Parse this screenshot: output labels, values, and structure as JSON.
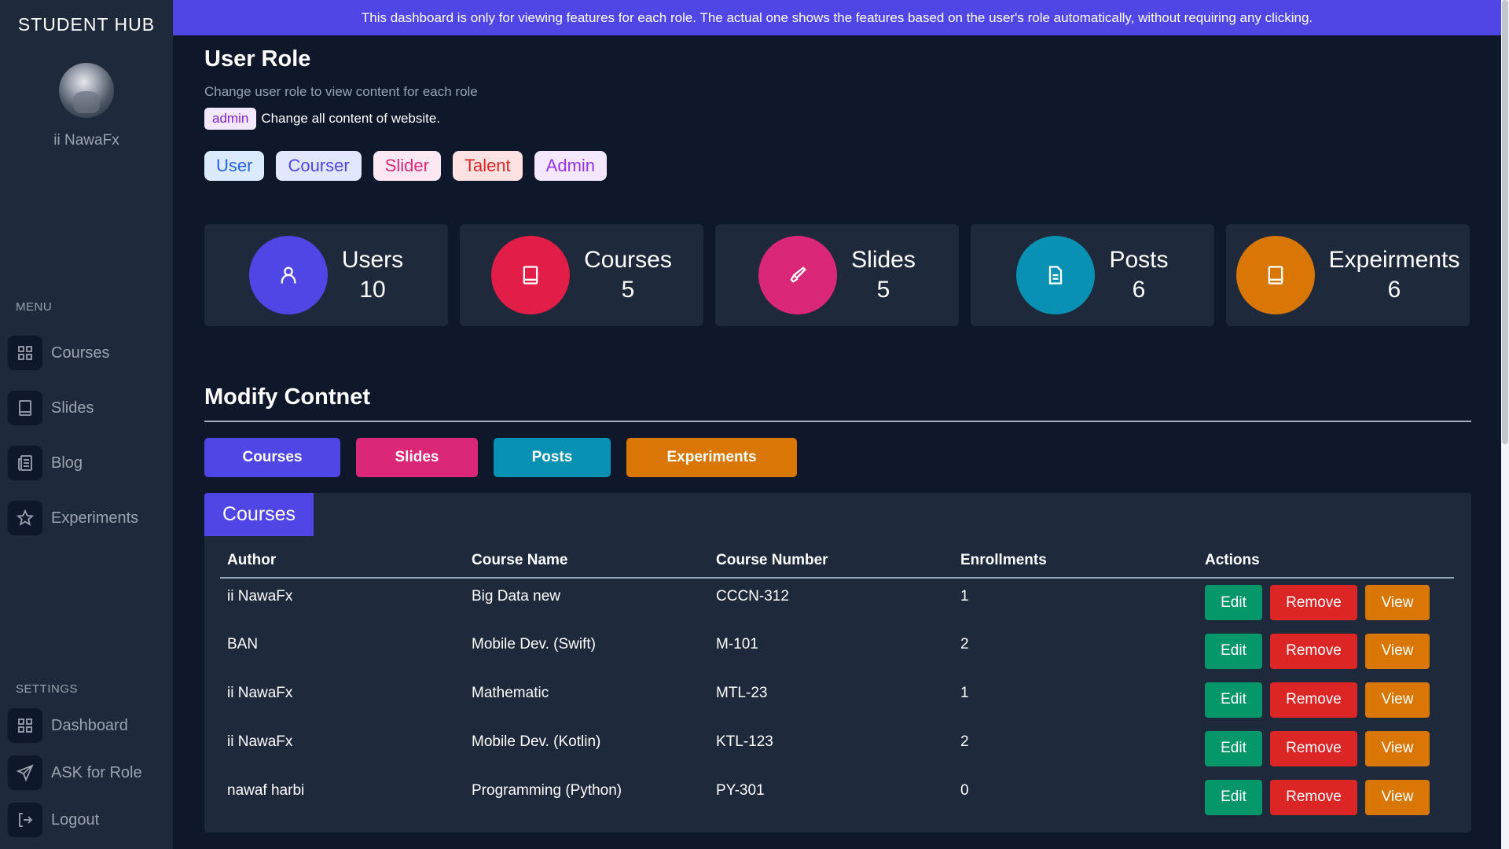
{
  "sidebar": {
    "brand": "STUDENT  HUB",
    "username": "ii NawaFx",
    "menu_label": "MENU",
    "menu_items": [
      {
        "label": "Courses",
        "icon": "grid-icon"
      },
      {
        "label": "Slides",
        "icon": "book-icon"
      },
      {
        "label": "Blog",
        "icon": "newspaper-icon"
      },
      {
        "label": "Experiments",
        "icon": "star-icon"
      }
    ],
    "settings_label": "SETTINGS",
    "settings_items": [
      {
        "label": "Dashboard",
        "icon": "grid-icon"
      },
      {
        "label": "ASK for Role",
        "icon": "send-icon"
      },
      {
        "label": "Logout",
        "icon": "logout-icon"
      }
    ]
  },
  "banner": {
    "text": "This dashboard is only for viewing features for each role. The actual one shows the features based on the user's role automatically, without requiring any clicking."
  },
  "role": {
    "title": "User Role",
    "subtitle": "Change user role to view content for each role",
    "current_badge": "admin",
    "current_desc": "Change all content of website.",
    "buttons": [
      {
        "label": "User",
        "bg": "#dbeafe",
        "fg": "#2563eb"
      },
      {
        "label": "Courser",
        "bg": "#e0e7ff",
        "fg": "#4f46e5"
      },
      {
        "label": "Slider",
        "bg": "#fce7f3",
        "fg": "#db2777"
      },
      {
        "label": "Talent",
        "bg": "#fee2e2",
        "fg": "#dc2626"
      },
      {
        "label": "Admin",
        "bg": "#f3e8ff",
        "fg": "#9333ea"
      }
    ]
  },
  "stats": [
    {
      "label": "Users",
      "value": "10",
      "color": "#4f46e5",
      "icon": "user-icon"
    },
    {
      "label": "Courses",
      "value": "5",
      "color": "#e11d48",
      "icon": "book-icon"
    },
    {
      "label": "Slides",
      "value": "5",
      "color": "#db2777",
      "icon": "brush-icon"
    },
    {
      "label": "Posts",
      "value": "6",
      "color": "#0891b2",
      "icon": "document-icon"
    },
    {
      "label": "Expeirments",
      "value": "6",
      "color": "#d97706",
      "icon": "book-icon"
    }
  ],
  "modify": {
    "title": "Modify Contnet",
    "tabs": [
      {
        "label": "Courses",
        "color": "#4f46e5"
      },
      {
        "label": "Slides",
        "color": "#db2777"
      },
      {
        "label": "Posts",
        "color": "#0891b2"
      },
      {
        "label": "Experiments",
        "color": "#d97706"
      }
    ],
    "panel_title": "Courses",
    "columns": [
      "Author",
      "Course Name",
      "Course Number",
      "Enrollments",
      "Actions"
    ],
    "rows": [
      {
        "author": "ii NawaFx",
        "name": "Big Data new",
        "number": "CCCN-312",
        "enrollments": "1"
      },
      {
        "author": "BAN",
        "name": "Mobile Dev. (Swift)",
        "number": "M-101",
        "enrollments": "2"
      },
      {
        "author": "ii NawaFx",
        "name": "Mathematic",
        "number": "MTL-23",
        "enrollments": "1"
      },
      {
        "author": "ii NawaFx",
        "name": "Mobile Dev. (Kotlin)",
        "number": "KTL-123",
        "enrollments": "2"
      },
      {
        "author": "nawaf harbi",
        "name": "Programming (Python)",
        "number": "PY-301",
        "enrollments": "0"
      }
    ],
    "actions": {
      "edit": "Edit",
      "remove": "Remove",
      "view": "View"
    }
  }
}
